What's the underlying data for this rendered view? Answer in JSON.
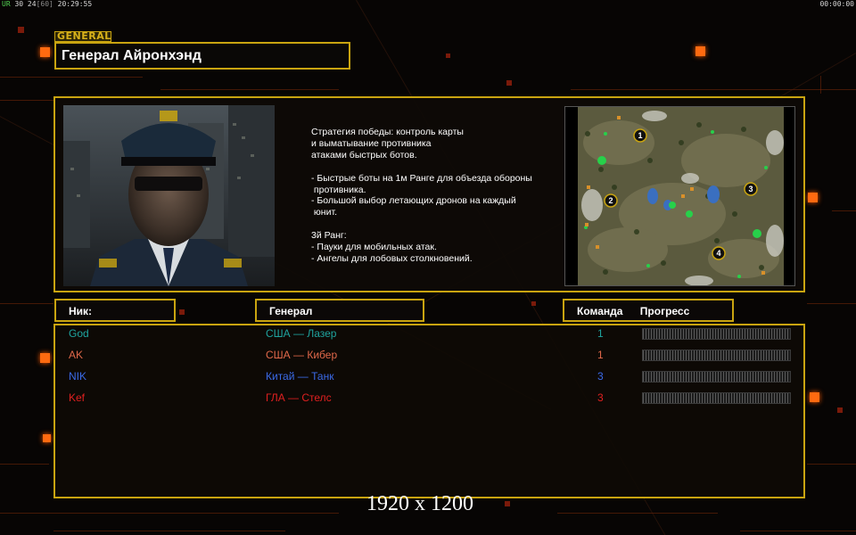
{
  "hud": {
    "left_prefix": "UR",
    "left_stats": "30 24",
    "left_bracket": "[60]",
    "left_time": "20:29:55",
    "right_time": "00:00:00"
  },
  "general_tag": "GENERAL",
  "general_name": "Генерал Айронхэнд",
  "strategy_text": "Стратегия победы: контроль карты\nи выматывание противника\nатаками быстрых ботов.\n\n- Быстрые боты на 1м Ранге для объезда обороны\n противника.\n- Большой выбор летающих дронов на каждый\n юнит.\n\n3й Ранг:\n- Пауки для мобильных атак.\n- Ангелы для лобовых столкновений.",
  "minimap": {
    "start_positions": [
      "1",
      "2",
      "3",
      "4"
    ]
  },
  "columns": {
    "nick": "Ник:",
    "general": "Генерал",
    "team": "Команда",
    "progress": "Прогресс"
  },
  "players": [
    {
      "nick": "God",
      "general": "США — Лазер",
      "team": "1",
      "color": "#1fa39e",
      "progress": 0
    },
    {
      "nick": "AK",
      "general": "США — Кибер",
      "team": "1",
      "color": "#e0684a",
      "progress": 0
    },
    {
      "nick": "NIK",
      "general": "Китай — Танк",
      "team": "3",
      "color": "#3a6ae8",
      "progress": 0
    },
    {
      "nick": "Kef",
      "general": "ГЛА — Стелс",
      "team": "3",
      "color": "#e02020",
      "progress": 0
    }
  ],
  "resolution_label": "1920 x 1200",
  "colors": {
    "frame": "#c9a410",
    "accent_orange": "#ff6a10"
  }
}
